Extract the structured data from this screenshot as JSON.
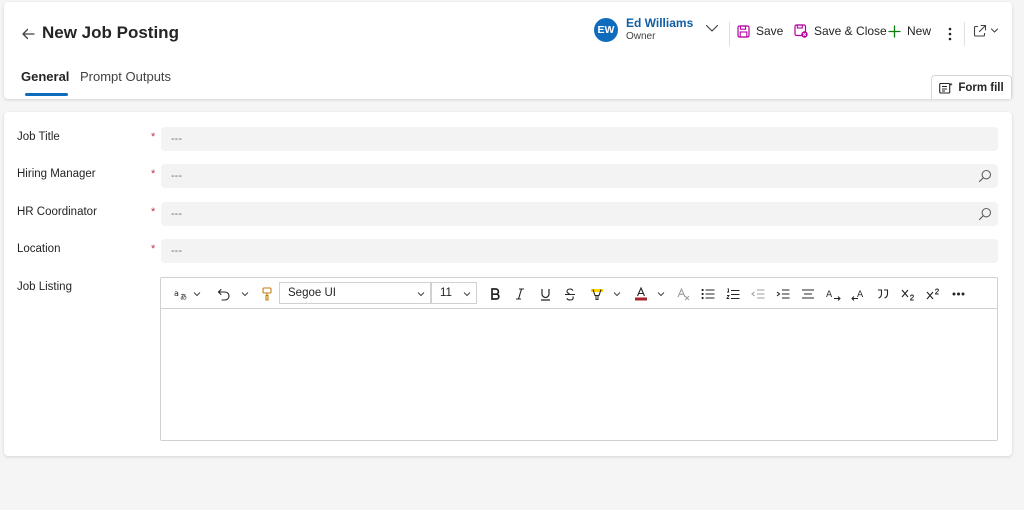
{
  "header": {
    "title": "New Job Posting",
    "owner": {
      "initials": "EW",
      "name": "Ed Williams",
      "role": "Owner"
    },
    "commands": {
      "save": "Save",
      "save_close": "Save & Close",
      "new": "New"
    },
    "tabs": [
      {
        "label": "General",
        "active": true
      },
      {
        "label": "Prompt Outputs",
        "active": false
      }
    ],
    "form_fill": "Form fill"
  },
  "form": {
    "required_mark": "*",
    "fields": [
      {
        "label": "Job Title",
        "placeholder": "---",
        "required": true,
        "lookup": false
      },
      {
        "label": "Hiring Manager",
        "placeholder": "---",
        "required": true,
        "lookup": true
      },
      {
        "label": "HR Coordinator",
        "placeholder": "---",
        "required": true,
        "lookup": true
      },
      {
        "label": "Location",
        "placeholder": "---",
        "required": true,
        "lookup": false
      }
    ],
    "job_listing": {
      "label": "Job Listing",
      "font_family": "Segoe UI",
      "font_size": "11",
      "body": ""
    }
  },
  "colors": {
    "accent": "#0f6cbd",
    "owner_name": "#115ea3",
    "save_icon": "#b4009e",
    "new_icon": "#107c10",
    "required": "#c4314b",
    "highlight": "#ffd200",
    "font_color": "#a4262c"
  },
  "icons": {
    "back": "arrow-left-icon",
    "save": "save-icon",
    "save_close": "save-close-icon",
    "new": "plus-icon",
    "more": "more-vertical-icon",
    "share": "share-icon",
    "lookup": "search-icon",
    "form_fill": "form-fill-icon"
  }
}
